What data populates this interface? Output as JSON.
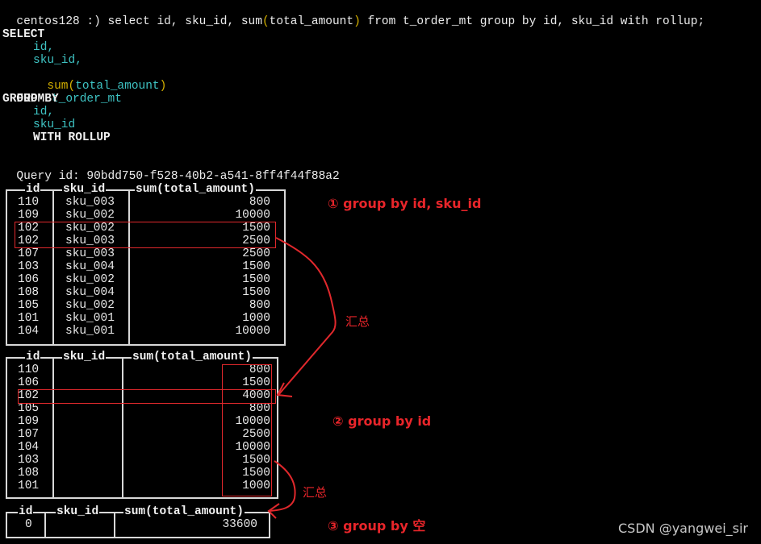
{
  "terminal": {
    "prompt": "centos128 :) ",
    "command_pre": "select id, sku_id, sum",
    "command_paren_open": "(",
    "command_mid": "total_amount",
    "command_paren_close": ")",
    "command_post": " from t_order_mt group by id, sku_id with rollup;",
    "formatted": {
      "select_kw": "SELECT",
      "col1": "id,",
      "col2": "sku_id,",
      "col3_func": "sum",
      "col3_open": "(",
      "col3_arg": "total_amount",
      "col3_close": ")",
      "from_kw": "FROM",
      "table": "t_order_mt",
      "group_kw": "GROUP BY",
      "g1": "id,",
      "g2": "sku_id",
      "rollup_kw": "WITH ROLLUP"
    },
    "query_id_label": "Query id: ",
    "query_id": "90bdd750-f528-40b2-a541-8ff4f44f88a2"
  },
  "tables": [
    {
      "headers": [
        "id",
        "sku_id",
        "sum(total_amount)"
      ],
      "rows": [
        [
          "110",
          "sku_003",
          "800"
        ],
        [
          "109",
          "sku_002",
          "10000"
        ],
        [
          "102",
          "sku_002",
          "1500"
        ],
        [
          "102",
          "sku_003",
          "2500"
        ],
        [
          "107",
          "sku_003",
          "2500"
        ],
        [
          "103",
          "sku_004",
          "1500"
        ],
        [
          "106",
          "sku_002",
          "1500"
        ],
        [
          "108",
          "sku_004",
          "1500"
        ],
        [
          "105",
          "sku_002",
          "800"
        ],
        [
          "101",
          "sku_001",
          "1000"
        ],
        [
          "104",
          "sku_001",
          "10000"
        ]
      ]
    },
    {
      "headers": [
        "id",
        "sku_id",
        "sum(total_amount)"
      ],
      "rows": [
        [
          "110",
          "",
          "800"
        ],
        [
          "106",
          "",
          "1500"
        ],
        [
          "102",
          "",
          "4000"
        ],
        [
          "105",
          "",
          "800"
        ],
        [
          "109",
          "",
          "10000"
        ],
        [
          "107",
          "",
          "2500"
        ],
        [
          "104",
          "",
          "10000"
        ],
        [
          "103",
          "",
          "1500"
        ],
        [
          "108",
          "",
          "1500"
        ],
        [
          "101",
          "",
          "1000"
        ]
      ]
    },
    {
      "headers": [
        "id",
        "sku_id",
        "sum(total_amount)"
      ],
      "rows": [
        [
          "0",
          "",
          "33600"
        ]
      ]
    }
  ],
  "annotations": {
    "label1": "① group by id, sku_id",
    "label2": "② group by id",
    "label3": "③ group by 空",
    "summary1": "汇总",
    "summary2": "汇总",
    "color": "#e8252a"
  },
  "watermark": "CSDN @yangwei_sir"
}
